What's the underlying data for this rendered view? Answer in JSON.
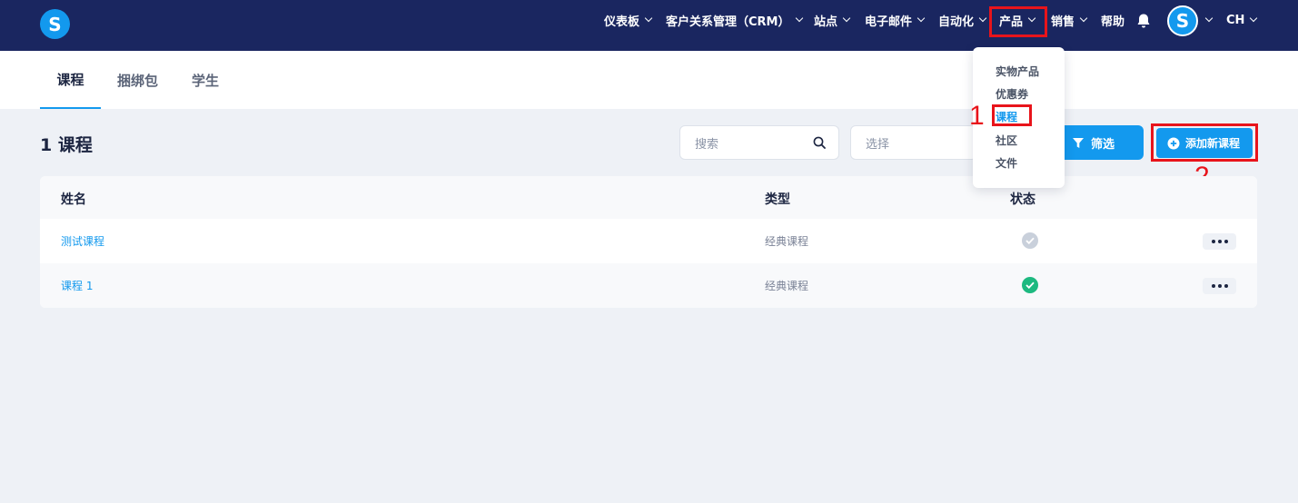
{
  "brand": {
    "logo_letter": "S"
  },
  "nav": {
    "items": [
      {
        "label": "仪表板"
      },
      {
        "label": "客户关系管理（CRM）"
      },
      {
        "label": "站点"
      },
      {
        "label": "电子邮件"
      },
      {
        "label": "自动化"
      },
      {
        "label": "产品"
      },
      {
        "label": "销售"
      },
      {
        "label": "帮助"
      }
    ],
    "avatar_letter": "S",
    "language": "CH"
  },
  "tabs": [
    {
      "label": "课程",
      "active": true
    },
    {
      "label": "捆绑包",
      "active": false
    },
    {
      "label": "学生",
      "active": false
    }
  ],
  "main": {
    "count_title": "1 课程",
    "search_placeholder": "搜索",
    "select_placeholder": "选择",
    "filter_label": "筛选",
    "add_label": "添加新课程"
  },
  "table": {
    "headers": {
      "name": "姓名",
      "type": "类型",
      "status": "状态"
    },
    "rows": [
      {
        "name": "测试课程",
        "type": "经典课程",
        "status": "inactive"
      },
      {
        "name": "课程 1",
        "type": "经典课程",
        "status": "active"
      }
    ]
  },
  "dropdown": {
    "items": [
      {
        "label": "实物产品"
      },
      {
        "label": "优惠券"
      },
      {
        "label": "课程"
      },
      {
        "label": "社区"
      },
      {
        "label": "文件"
      }
    ]
  },
  "annotations": {
    "step1": "1",
    "step2": "2"
  },
  "colors": {
    "nav_bg": "#1a2660",
    "accent": "#1399ee",
    "highlight": "#e8141b",
    "success": "#1db980",
    "muted": "#c9d0db"
  }
}
